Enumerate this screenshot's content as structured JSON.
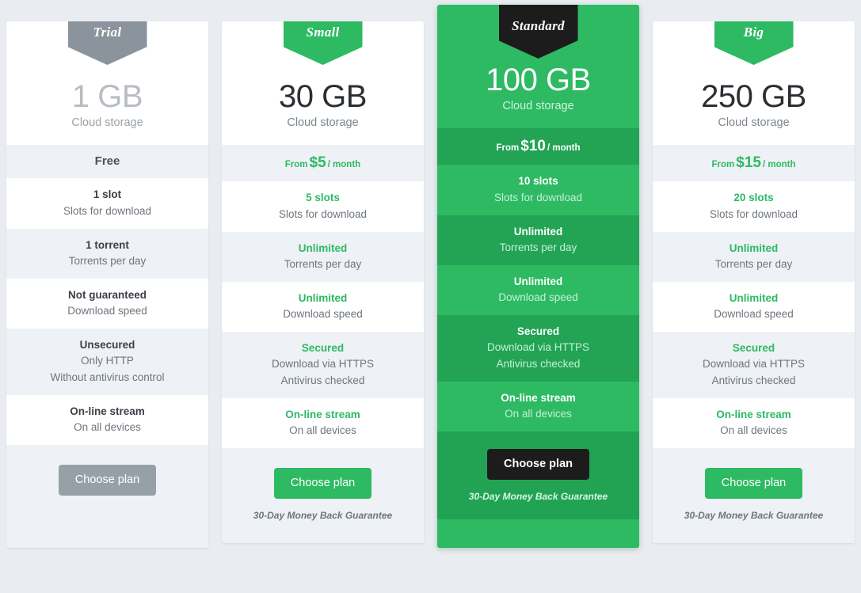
{
  "labels": {
    "storage_caption": "Cloud storage",
    "choose_plan": "Choose plan",
    "guarantee": "30-Day Money Back Guarantee",
    "price_from": "From",
    "price_per": "/ month"
  },
  "colors": {
    "accent_green": "#2dba63",
    "featured_bg": "#2dba63",
    "featured_alt_row": "#22a454",
    "trial_gray": "#8b949c",
    "dark_ribbon": "#1c1c1c",
    "page_bg": "#e9edf1",
    "row_alt_bg": "#eef1f5"
  },
  "plans": [
    {
      "id": "trial",
      "ribbon": "Trial",
      "storage": "1 GB",
      "storage_caption": "Cloud storage",
      "price_free": "Free",
      "price_from": "",
      "price_amount": "",
      "price_per": "",
      "features": [
        {
          "title": "1 slot",
          "lines": [
            "Slots for download"
          ]
        },
        {
          "title": "1 torrent",
          "lines": [
            "Torrents per day"
          ]
        },
        {
          "title": "Not guaranteed",
          "lines": [
            "Download speed"
          ]
        },
        {
          "title": "Unsecured",
          "lines": [
            "Only HTTP",
            "Without antivirus control"
          ]
        },
        {
          "title": "On-line stream",
          "lines": [
            "On all devices"
          ]
        }
      ],
      "button": "Choose plan",
      "guarantee": ""
    },
    {
      "id": "small",
      "ribbon": "Small",
      "storage": "30 GB",
      "storage_caption": "Cloud storage",
      "price_free": "",
      "price_from": "From",
      "price_amount": "$5",
      "price_per": "/ month",
      "features": [
        {
          "title": "5 slots",
          "lines": [
            "Slots for download"
          ]
        },
        {
          "title": "Unlimited",
          "lines": [
            "Torrents per day"
          ]
        },
        {
          "title": "Unlimited",
          "lines": [
            "Download speed"
          ]
        },
        {
          "title": "Secured",
          "lines": [
            "Download via HTTPS",
            "Antivirus checked"
          ]
        },
        {
          "title": "On-line stream",
          "lines": [
            "On all devices"
          ]
        }
      ],
      "button": "Choose plan",
      "guarantee": "30-Day Money Back Guarantee"
    },
    {
      "id": "standard",
      "ribbon": "Standard",
      "storage": "100 GB",
      "storage_caption": "Cloud storage",
      "price_free": "",
      "price_from": "From",
      "price_amount": "$10",
      "price_per": "/ month",
      "features": [
        {
          "title": "10 slots",
          "lines": [
            "Slots for download"
          ]
        },
        {
          "title": "Unlimited",
          "lines": [
            "Torrents per day"
          ]
        },
        {
          "title": "Unlimited",
          "lines": [
            "Download speed"
          ]
        },
        {
          "title": "Secured",
          "lines": [
            "Download via HTTPS",
            "Antivirus checked"
          ]
        },
        {
          "title": "On-line stream",
          "lines": [
            "On all devices"
          ]
        }
      ],
      "button": "Choose plan",
      "guarantee": "30-Day Money Back Guarantee"
    },
    {
      "id": "big",
      "ribbon": "Big",
      "storage": "250 GB",
      "storage_caption": "Cloud storage",
      "price_free": "",
      "price_from": "From",
      "price_amount": "$15",
      "price_per": "/ month",
      "features": [
        {
          "title": "20 slots",
          "lines": [
            "Slots for download"
          ]
        },
        {
          "title": "Unlimited",
          "lines": [
            "Torrents per day"
          ]
        },
        {
          "title": "Unlimited",
          "lines": [
            "Download speed"
          ]
        },
        {
          "title": "Secured",
          "lines": [
            "Download via HTTPS",
            "Antivirus checked"
          ]
        },
        {
          "title": "On-line stream",
          "lines": [
            "On all devices"
          ]
        }
      ],
      "button": "Choose plan",
      "guarantee": "30-Day Money Back Guarantee"
    }
  ]
}
